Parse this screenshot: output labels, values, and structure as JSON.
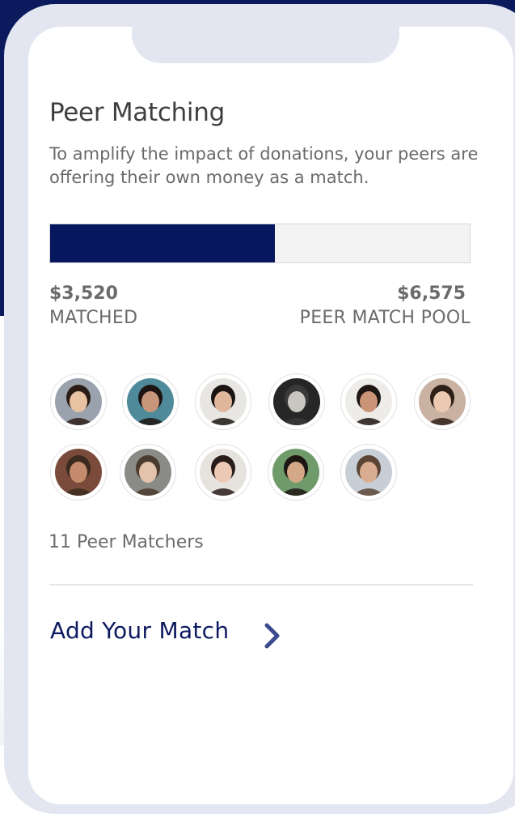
{
  "colors": {
    "accent": "#06175e",
    "link": "#0d1a60",
    "track": "#f3f3f4",
    "frame": "#e3e6f0",
    "backdrop": "#0b1a5c"
  },
  "card": {
    "title": "Peer Matching",
    "description": "To amplify the impact of donations, your peers are offering their own money as a match."
  },
  "progress": {
    "matched_amount": "$3,520",
    "matched_label": "MATCHED",
    "pool_amount": "$6,575",
    "pool_label": "PEER MATCH POOL",
    "fraction": 0.5354
  },
  "matchers": {
    "count_text": "11 Peer Matchers",
    "avatars": [
      {
        "icon": "person-photo-1",
        "bg": "#9aa3ad",
        "skin": "#e7c2a3",
        "hair": "#2b1d16"
      },
      {
        "icon": "person-photo-2",
        "bg": "#4e8a9a",
        "skin": "#c8967a",
        "hair": "#1c1411"
      },
      {
        "icon": "person-photo-3",
        "bg": "#e8e6e2",
        "skin": "#e1b79b",
        "hair": "#1a1512"
      },
      {
        "icon": "person-photo-4",
        "bg": "#262626",
        "skin": "#c9c6c2",
        "hair": "#3a3a3a"
      },
      {
        "icon": "person-photo-5",
        "bg": "#eeece8",
        "skin": "#c99477",
        "hair": "#1e1612"
      },
      {
        "icon": "person-photo-6",
        "bg": "#c9b2a2",
        "skin": "#eccab1",
        "hair": "#2e1f18"
      },
      {
        "icon": "person-photo-7",
        "bg": "#7a4a3a",
        "skin": "#c48c6c",
        "hair": "#3b2a20"
      },
      {
        "icon": "person-photo-8",
        "bg": "#8a8a86",
        "skin": "#e3c3aa",
        "hair": "#4b3a2e"
      },
      {
        "icon": "person-photo-9",
        "bg": "#e6e3df",
        "skin": "#ecc9b4",
        "hair": "#2a1d19"
      },
      {
        "icon": "person-photo-10",
        "bg": "#6f9a6a",
        "skin": "#d5a887",
        "hair": "#1d1714"
      },
      {
        "icon": "person-photo-11",
        "bg": "#c8ced6",
        "skin": "#d9ae90",
        "hair": "#5a4535"
      }
    ]
  },
  "action": {
    "label": "Add Your Match",
    "icon": "chevron-right-icon"
  }
}
